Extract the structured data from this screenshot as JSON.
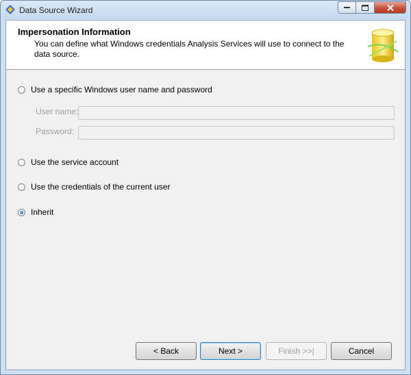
{
  "window": {
    "title": "Data Source Wizard"
  },
  "header": {
    "title": "Impersonation Information",
    "description": "You can define what Windows credentials Analysis Services will use to connect to the data source."
  },
  "options": [
    {
      "label": "Use a specific Windows user name and password",
      "checked": false
    },
    {
      "label": "Use the service account",
      "checked": false
    },
    {
      "label": "Use the credentials of the current user",
      "checked": false
    },
    {
      "label": "Inherit",
      "checked": true
    }
  ],
  "fields": {
    "username": {
      "label": "User name:",
      "value": ""
    },
    "password": {
      "label": "Password:",
      "value": ""
    }
  },
  "buttons": {
    "back": "< Back",
    "next": "Next >",
    "finish": "Finish >>|",
    "cancel": "Cancel"
  }
}
